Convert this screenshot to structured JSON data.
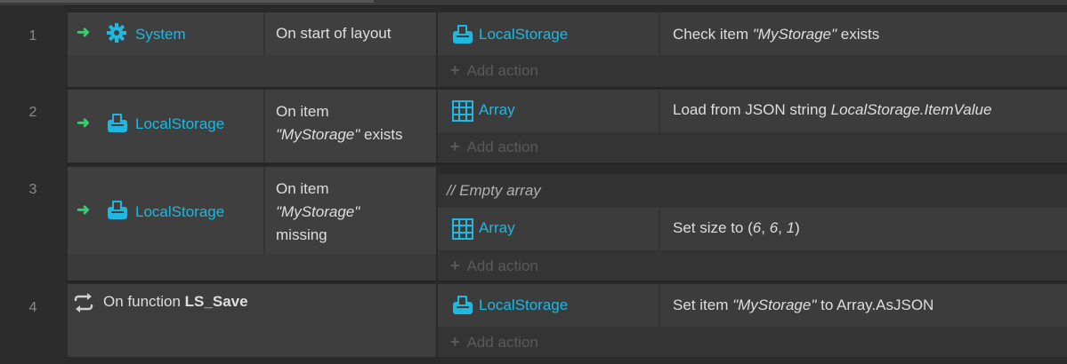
{
  "rows": [
    {
      "number": "1",
      "condition": {
        "object": "System",
        "text": "On start of layout"
      },
      "action": {
        "object": "LocalStorage",
        "text_pre": "Check item ",
        "text_italic": "\"MyStorage\"",
        "text_post": " exists"
      },
      "add_action": "Add action"
    },
    {
      "number": "2",
      "condition": {
        "object": "LocalStorage",
        "line1": "On item",
        "line2_italic": "\"MyStorage\"",
        "line2_post": " exists"
      },
      "action": {
        "object": "Array",
        "text_pre": "Load from JSON string ",
        "text_italic": "LocalStorage.ItemValue"
      },
      "add_action": "Add action"
    },
    {
      "number": "3",
      "condition": {
        "object": "LocalStorage",
        "line1": "On item",
        "line2_italic": "\"MyStorage\"",
        "line3": "missing"
      },
      "comment": "//  Empty array",
      "action": {
        "object": "Array",
        "text_pre": "Set size to (",
        "v1": "6",
        "sep1": ", ",
        "v2": "6",
        "sep2": ", ",
        "v3": "1",
        "text_post": ")"
      },
      "add_action": "Add action"
    },
    {
      "number": "4",
      "function": {
        "prefix": "On function ",
        "name": "LS_Save"
      },
      "action": {
        "object": "LocalStorage",
        "text_pre": "Set item ",
        "text_italic": "\"MyStorage\"",
        "text_post": " to Array.AsJSON"
      },
      "add_action": "Add action"
    }
  ],
  "colors": {
    "object_name": "#1fb8e0",
    "trigger_arrow": "#2fd36a",
    "background": "#2a2a2a"
  }
}
